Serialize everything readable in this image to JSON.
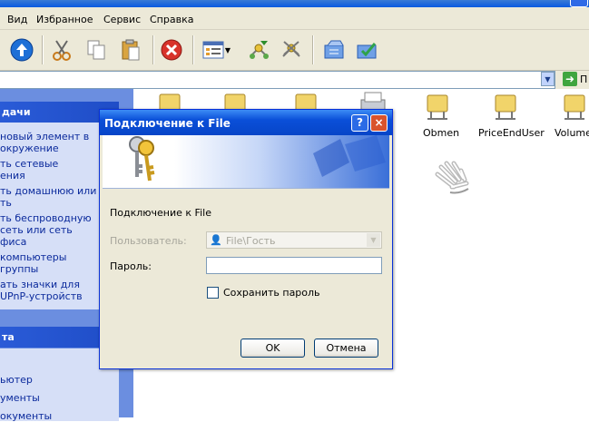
{
  "menubar": {
    "items": [
      "Вид",
      "Избранное",
      "Сервис",
      "Справка"
    ]
  },
  "toolbar": {
    "buttons": [
      "up-folder",
      "cut",
      "copy",
      "paste",
      "delete",
      "views",
      "map-network-drive",
      "disconnect-network-drive",
      "sync",
      "synchronize-check"
    ]
  },
  "addressbar": {
    "go_label": "П"
  },
  "taskpane": {
    "tasks_header": "дачи",
    "tasks_links": [
      "элемент в окружение",
      "ть сетевые ения",
      "ть домашнюю или ть",
      "ть беспроводную сеть или сеть фиса",
      "компьютеры группы",
      "ать значки для UPnP-устройств"
    ],
    "tasks_links_full": [
      [
        "элемент в",
        "окружение"
      ],
      [
        "ть сетевые",
        "ения"
      ],
      [
        "ть домашнюю или",
        "ть"
      ],
      [
        "ть беспроводную",
        "сеть или сеть",
        "фиса"
      ],
      [
        "компьютеры",
        "группы"
      ],
      [
        "ать значки для",
        "UPnP-устройств"
      ]
    ],
    "tasks_link_first": "новый элемент в",
    "other_header": "та",
    "other_links": [
      "ьютер",
      "ументы",
      "окументы"
    ]
  },
  "content": {
    "items": [
      {
        "label": ""
      },
      {
        "label": ""
      },
      {
        "label": ""
      },
      {
        "label": "Obmen"
      },
      {
        "label": "PriceEndUser"
      },
      {
        "label": "Volume_"
      }
    ]
  },
  "dialog": {
    "title": "Подключение к File",
    "subtitle": "Подключение к File",
    "user_label": "Пользователь:",
    "user_value": "File\\Гость",
    "password_label": "Пароль:",
    "password_value": "",
    "save_password_label": "Сохранить пароль",
    "save_password_checked": false,
    "ok_label": "OK",
    "cancel_label": "Отмена",
    "help_label": "?",
    "close_label": "×"
  },
  "colors": {
    "title_blue": "#0a4fd8",
    "taskpane_blue": "#6b8ee0",
    "dialog_bg": "#ece9d8",
    "link_blue": "#0b2a9c"
  }
}
